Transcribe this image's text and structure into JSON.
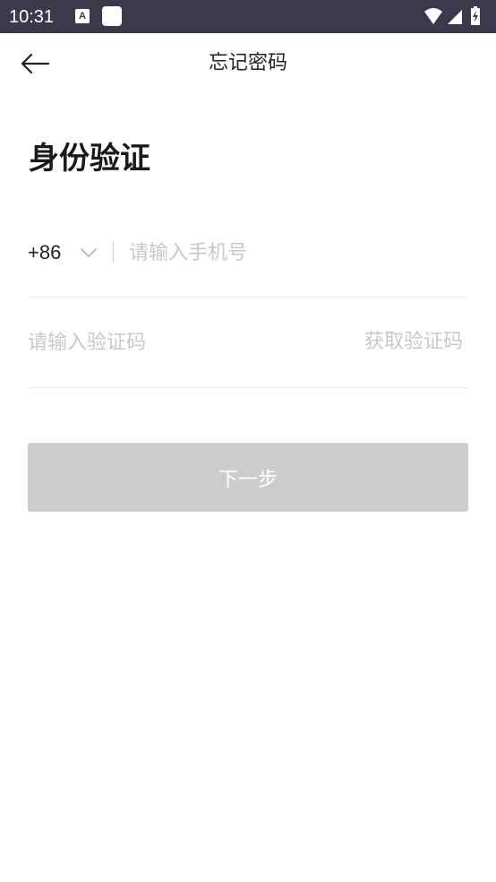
{
  "status_bar": {
    "time": "10:31",
    "notification_letter": "A",
    "icons": [
      "wifi-icon",
      "cell-signal-icon",
      "battery-charging-icon"
    ]
  },
  "nav": {
    "back_icon": "arrow-left-icon",
    "title": "忘记密码"
  },
  "heading": "身份验证",
  "phone": {
    "country_code": "+86",
    "chevron_icon": "chevron-down-icon",
    "placeholder": "请输入手机号",
    "value": ""
  },
  "code": {
    "placeholder": "请输入验证码",
    "value": "",
    "get_code_label": "获取验证码"
  },
  "next_button": {
    "label": "下一步"
  },
  "colors": {
    "status_bar_bg": "#3a3a4c",
    "placeholder": "#c8c8c8",
    "divider": "#e6e6e6",
    "button_disabled_bg": "#cccccc",
    "text_primary": "#222222"
  }
}
